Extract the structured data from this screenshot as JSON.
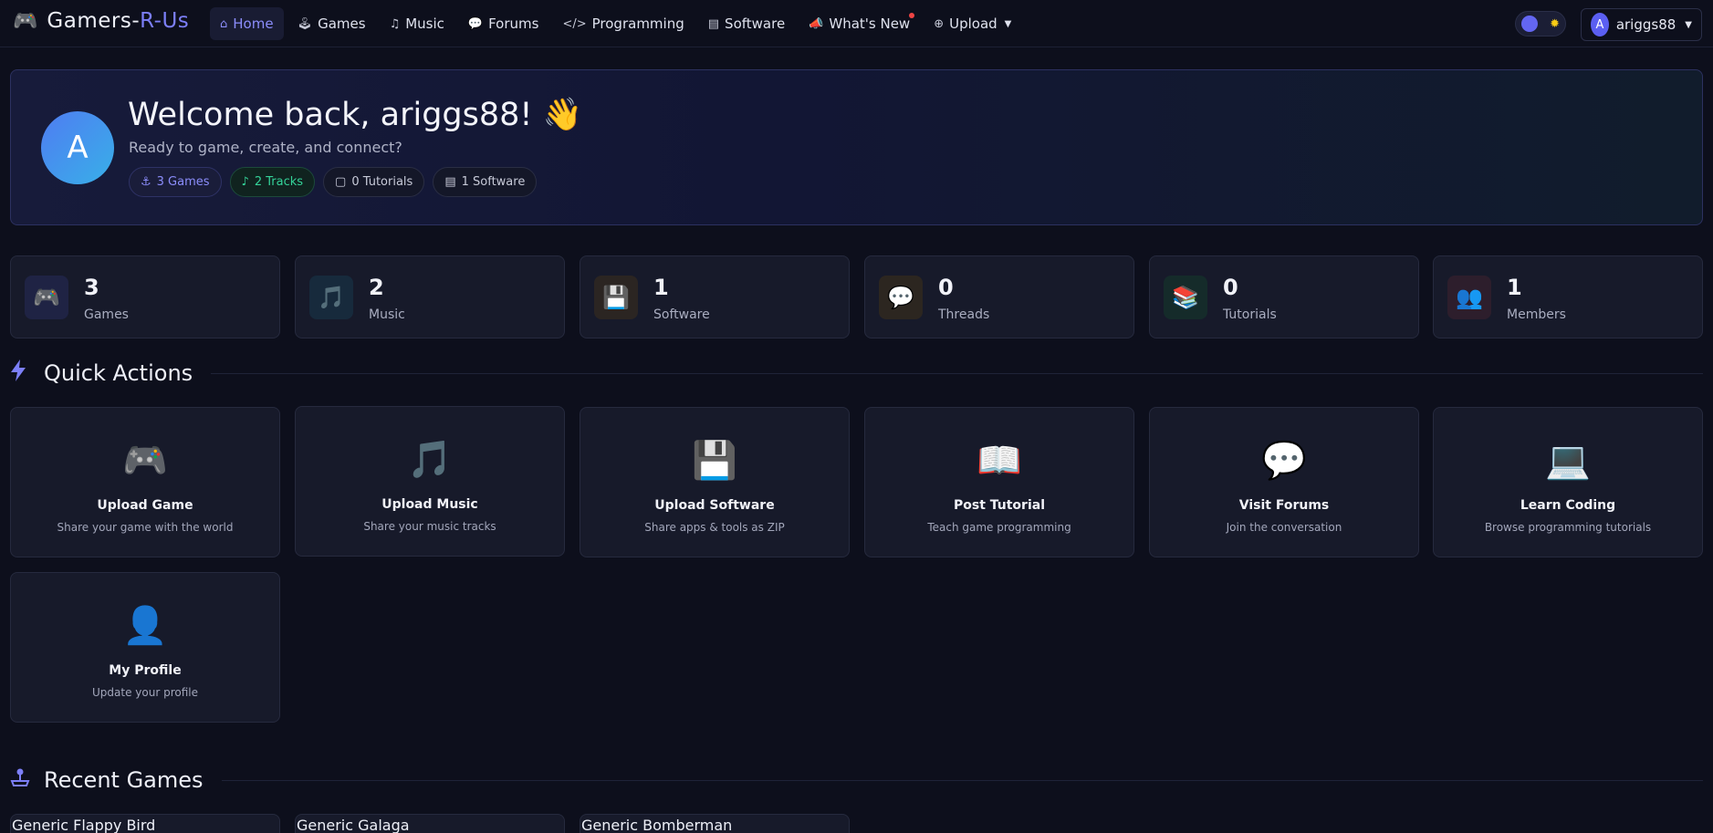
{
  "brand": {
    "icon": "gamepad-icon",
    "name_main": "Gamers-",
    "name_accent": "R-Us"
  },
  "nav": [
    {
      "label": "Home",
      "icon": "home-icon",
      "glyph": "⌂",
      "active": true
    },
    {
      "label": "Games",
      "icon": "joystick-icon",
      "glyph": "🕹"
    },
    {
      "label": "Music",
      "icon": "music-note-icon",
      "glyph": "♫"
    },
    {
      "label": "Forums",
      "icon": "chat-icon",
      "glyph": "💬"
    },
    {
      "label": "Programming",
      "icon": "code-icon",
      "glyph": "</>"
    },
    {
      "label": "Software",
      "icon": "file-icon",
      "glyph": "▤"
    },
    {
      "label": "What's New",
      "icon": "megaphone-icon",
      "glyph": "📣",
      "dot": true
    },
    {
      "label": "Upload",
      "icon": "plus-circle-icon",
      "glyph": "⊕",
      "caret": true
    }
  ],
  "user": {
    "initial": "A",
    "name": "ariggs88"
  },
  "hero": {
    "initial": "A",
    "title": "Welcome back, ariggs88! 👋",
    "subtitle": "Ready to game, create, and connect?",
    "badges": [
      {
        "label": "3 Games",
        "icon": "joystick-icon",
        "glyph": "⚓"
      },
      {
        "label": "2 Tracks",
        "icon": "music-note-icon",
        "glyph": "♪"
      },
      {
        "label": "0 Tutorials",
        "icon": "book-icon",
        "glyph": "▢"
      },
      {
        "label": "1 Software",
        "icon": "file-icon",
        "glyph": "▤"
      }
    ]
  },
  "stats": [
    {
      "value": "3",
      "label": "Games",
      "icon": "gamepad-icon",
      "glyph": "🎮",
      "bg": "#1f2344"
    },
    {
      "value": "2",
      "label": "Music",
      "icon": "music-notes-icon",
      "glyph": "🎵",
      "bg": "#172a3c"
    },
    {
      "value": "1",
      "label": "Software",
      "icon": "floppy-disk-icon",
      "glyph": "💾",
      "bg": "#2b2522"
    },
    {
      "value": "0",
      "label": "Threads",
      "icon": "speech-bubble-icon",
      "glyph": "💬",
      "bg": "#2c2620"
    },
    {
      "value": "0",
      "label": "Tutorials",
      "icon": "books-icon",
      "glyph": "📚",
      "bg": "#152b2a"
    },
    {
      "value": "1",
      "label": "Members",
      "icon": "people-icon",
      "glyph": "👥",
      "bg": "#2d1e2c"
    }
  ],
  "quick_actions": {
    "title": "Quick Actions",
    "icon": "lightning-icon",
    "items": [
      {
        "title": "Upload Game",
        "desc": "Share your game with the world",
        "icon": "gamepad-icon",
        "glyph": "🎮"
      },
      {
        "title": "Upload Music",
        "desc": "Share your music tracks",
        "icon": "music-notes-icon",
        "glyph": "🎵"
      },
      {
        "title": "Upload Software",
        "desc": "Share apps & tools as ZIP",
        "icon": "floppy-disk-icon",
        "glyph": "💾"
      },
      {
        "title": "Post Tutorial",
        "desc": "Teach game programming",
        "icon": "open-book-icon",
        "glyph": "📖"
      },
      {
        "title": "Visit Forums",
        "desc": "Join the conversation",
        "icon": "speech-bubble-icon",
        "glyph": "💬"
      },
      {
        "title": "Learn Coding",
        "desc": "Browse programming tutorials",
        "icon": "laptop-icon",
        "glyph": "💻"
      },
      {
        "title": "My Profile",
        "desc": "Update your profile",
        "icon": "person-icon",
        "glyph": "👤"
      }
    ]
  },
  "recent_games": {
    "title": "Recent Games",
    "icon": "joystick-icon",
    "items": [
      {
        "title": "Generic Flappy Bird"
      },
      {
        "title": "Generic Galaga"
      },
      {
        "title": "Generic Bomberman"
      }
    ]
  },
  "colors": {
    "accent": "#7c7ff8",
    "background": "#0d0f1c",
    "card": "#171a2a",
    "green": "#34d399"
  }
}
